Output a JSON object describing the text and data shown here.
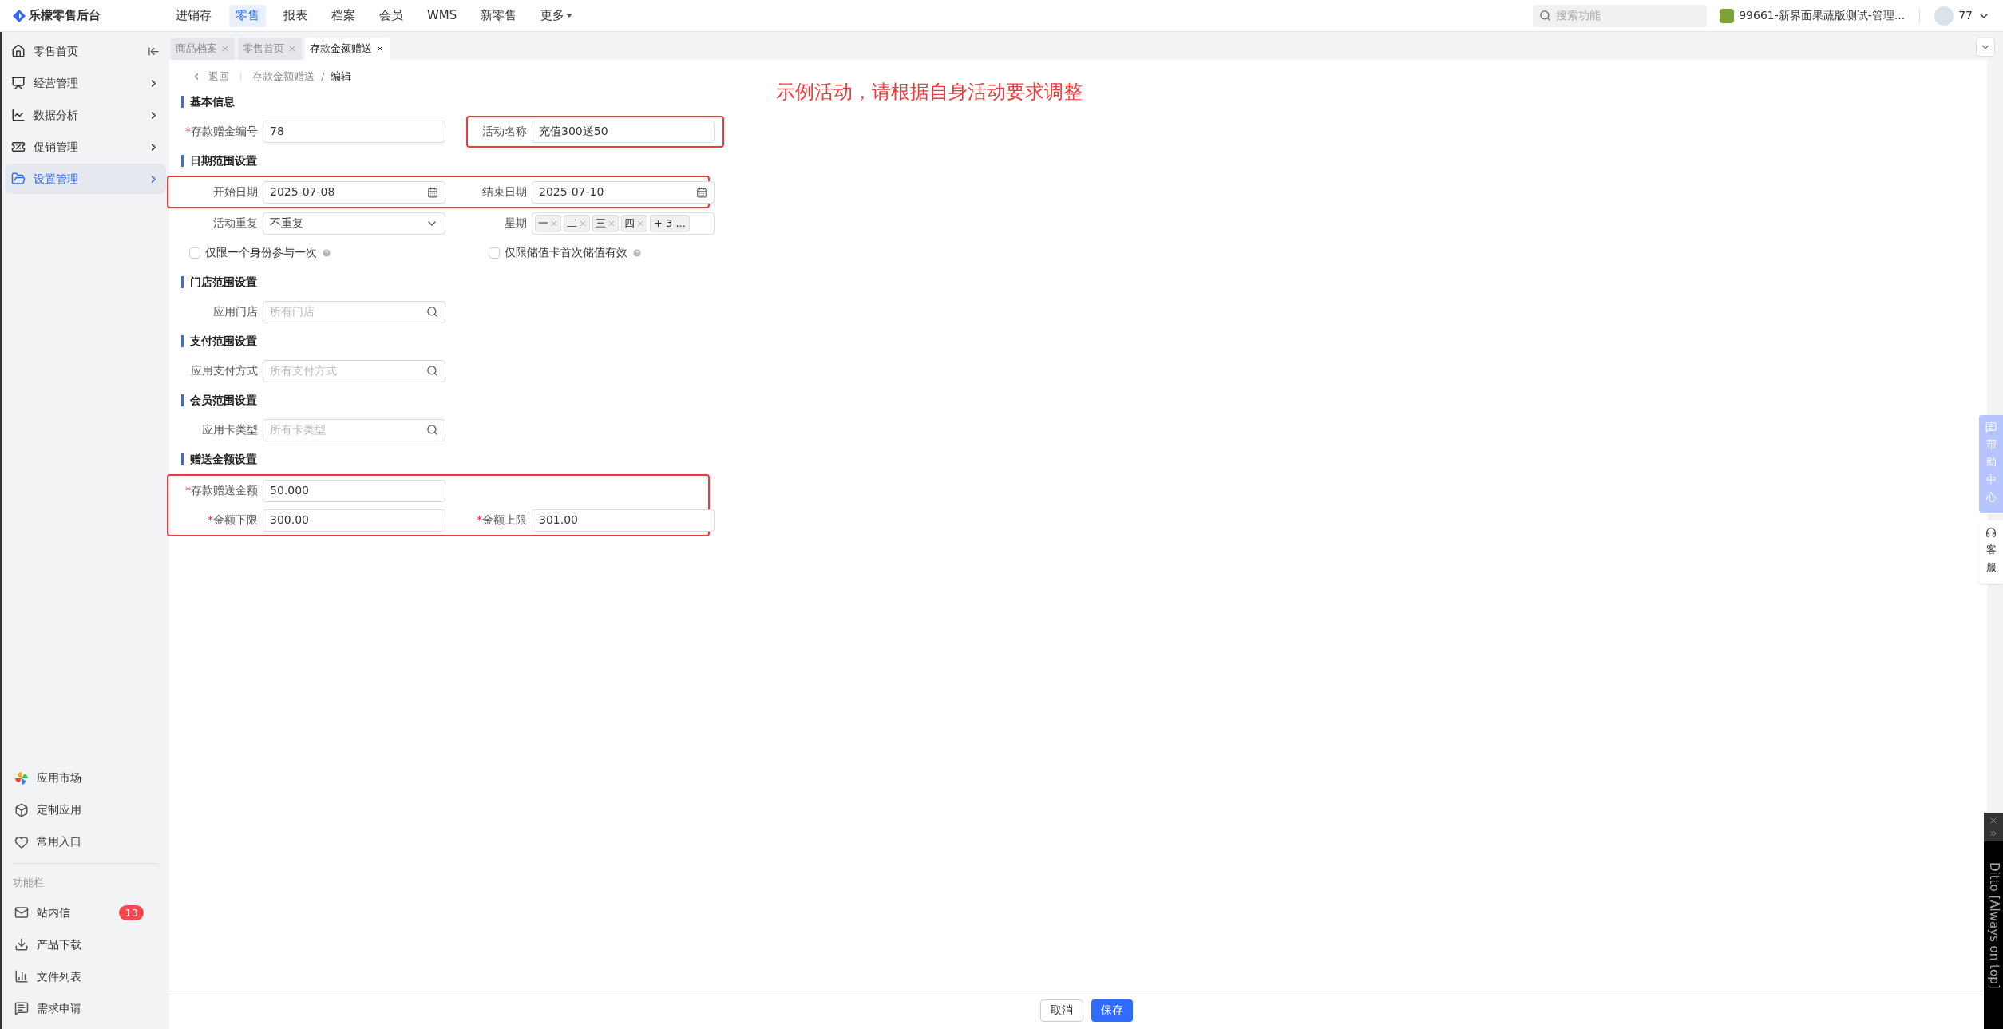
{
  "app": {
    "title": "乐檬零售后台"
  },
  "top_nav": [
    {
      "label": "进销存",
      "selected": false,
      "caret": false
    },
    {
      "label": "零售",
      "selected": true,
      "caret": false
    },
    {
      "label": "报表",
      "selected": false,
      "caret": false
    },
    {
      "label": "档案",
      "selected": false,
      "caret": false
    },
    {
      "label": "会员",
      "selected": false,
      "caret": false
    },
    {
      "label": "WMS",
      "selected": false,
      "caret": false
    },
    {
      "label": "新零售",
      "selected": false,
      "caret": false
    },
    {
      "label": "更多",
      "selected": false,
      "caret": true
    }
  ],
  "search": {
    "placeholder": "搜索功能"
  },
  "store": "99661-新界面果蔬版测试-管理...",
  "user": "77",
  "sidebar": {
    "items": [
      {
        "label": "零售首页",
        "selected": false,
        "kind": "home"
      },
      {
        "label": "经营管理",
        "selected": false,
        "kind": "group"
      },
      {
        "label": "数据分析",
        "selected": false,
        "kind": "group"
      },
      {
        "label": "促销管理",
        "selected": false,
        "kind": "group"
      },
      {
        "label": "设置管理",
        "selected": true,
        "kind": "group"
      }
    ],
    "apps": [
      "应用市场",
      "定制应用",
      "常用入口"
    ],
    "section_label": "功能栏",
    "tools": [
      {
        "label": "站内信",
        "badge": "13"
      },
      {
        "label": "产品下载"
      },
      {
        "label": "文件列表"
      },
      {
        "label": "需求申请"
      }
    ]
  },
  "tabs": [
    {
      "label": "商品档案",
      "selected": false
    },
    {
      "label": "零售首页",
      "selected": false
    },
    {
      "label": "存款金额赠送",
      "selected": true
    }
  ],
  "breadcrumb": {
    "back": "返回",
    "path": "存款金额赠送",
    "separator": "/",
    "current": "编辑"
  },
  "annotation": "示例活动，请根据自身活动要求调整",
  "sections": [
    {
      "title": "基本信息",
      "rows": [
        {
          "highlighted": false,
          "fields": [
            {
              "kind": "text",
              "label": "存款赠金编号",
              "required_mark": "*",
              "highlighted": false,
              "value": "78"
            },
            {
              "kind": "text",
              "label": "活动名称",
              "highlighted": true,
              "value": "充值300送50"
            }
          ]
        }
      ]
    },
    {
      "title": "日期范围设置",
      "rows": [
        {
          "highlighted": true,
          "fields": [
            {
              "kind": "date",
              "label": "开始日期",
              "highlighted": false,
              "value": "2025-07-08"
            },
            {
              "kind": "date",
              "label": "结束日期",
              "highlighted": false,
              "value": "2025-07-10"
            }
          ]
        },
        {
          "highlighted": false,
          "fields": [
            {
              "kind": "select",
              "label": "活动重复",
              "highlighted": false,
              "value": "不重复"
            },
            {
              "kind": "tags",
              "label": "星期",
              "highlighted": false,
              "tags": [
                "一",
                "二",
                "三",
                "四"
              ],
              "more": "+ 3 ..."
            }
          ]
        },
        {
          "highlighted": false,
          "fields": [
            {
              "kind": "checkbox",
              "label": "仅限一个身份参与一次",
              "checked": false,
              "highlighted": false
            },
            {
              "kind": "checkbox",
              "label": "仅限储值卡首次储值有效",
              "checked": false,
              "highlighted": false
            }
          ]
        }
      ]
    },
    {
      "title": "门店范围设置",
      "rows": [
        {
          "highlighted": false,
          "fields": [
            {
              "kind": "search",
              "label": "应用门店",
              "highlighted": false,
              "placeholder": "所有门店"
            }
          ]
        }
      ]
    },
    {
      "title": "支付范围设置",
      "rows": [
        {
          "highlighted": false,
          "fields": [
            {
              "kind": "search",
              "label": "应用支付方式",
              "highlighted": false,
              "placeholder": "所有支付方式"
            }
          ]
        }
      ]
    },
    {
      "title": "会员范围设置",
      "rows": [
        {
          "highlighted": false,
          "fields": [
            {
              "kind": "search",
              "label": "应用卡类型",
              "highlighted": false,
              "placeholder": "所有卡类型"
            }
          ]
        }
      ]
    },
    {
      "title": "赠送金额设置",
      "rows": [
        {
          "highlighted": true,
          "fields": [
            {
              "kind": "text",
              "label": "存款赠送金额",
              "required_mark": "*",
              "highlighted": false,
              "value": "50.000"
            }
          ]
        },
        {
          "highlighted": true,
          "fields": [
            {
              "kind": "text",
              "label": "金额下限",
              "required_mark": "*",
              "highlighted": false,
              "value": "300.00"
            },
            {
              "kind": "text",
              "label": "金额上限",
              "required_mark": "*",
              "highlighted": false,
              "value": "301.00"
            }
          ]
        }
      ]
    }
  ],
  "footer": [
    {
      "label": "取消",
      "kind": "secondary"
    },
    {
      "label": "保存",
      "kind": "primary"
    }
  ],
  "floating": [
    {
      "label": "帮助中心",
      "kind": "help"
    },
    {
      "label": "客服",
      "kind": "service"
    }
  ],
  "ditto": {
    "title": "Ditto [Always on top]"
  }
}
